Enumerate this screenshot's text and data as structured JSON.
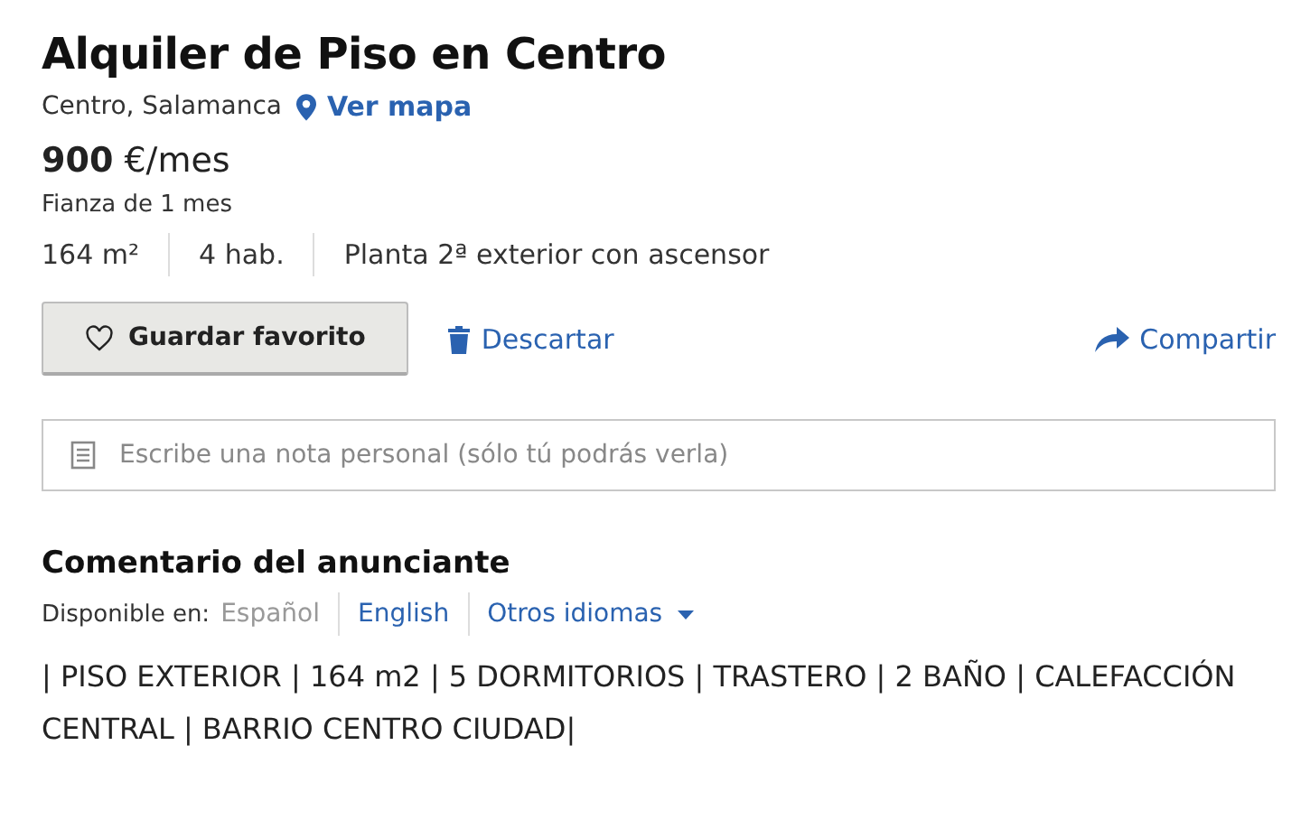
{
  "title": "Alquiler de Piso en Centro",
  "location": {
    "text": "Centro, Salamanca",
    "map_link": "Ver mapa"
  },
  "price": {
    "amount": "900",
    "unit": "€/mes"
  },
  "deposit": "Fianza de 1 mes",
  "features": [
    "164 m²",
    "4 hab.",
    "Planta 2ª exterior con ascensor"
  ],
  "actions": {
    "favorite": "Guardar favorito",
    "discard": "Descartar",
    "share": "Compartir"
  },
  "note": {
    "placeholder": "Escribe una nota personal (sólo tú podrás verla)"
  },
  "comment": {
    "heading": "Comentario del anunciante",
    "available_label": "Disponible en:",
    "languages": [
      {
        "label": "Español",
        "selected": true,
        "kind": "option"
      },
      {
        "label": "English",
        "selected": false,
        "kind": "option"
      },
      {
        "label": "Otros idiomas",
        "selected": false,
        "kind": "dropdown"
      }
    ],
    "text": "| PISO EXTERIOR | 164 m2 | 5 DORMITORIOS | TRASTERO | 2 BAÑO | CALEFACCIÓN CENTRAL | BARRIO CENTRO CIUDAD|"
  }
}
